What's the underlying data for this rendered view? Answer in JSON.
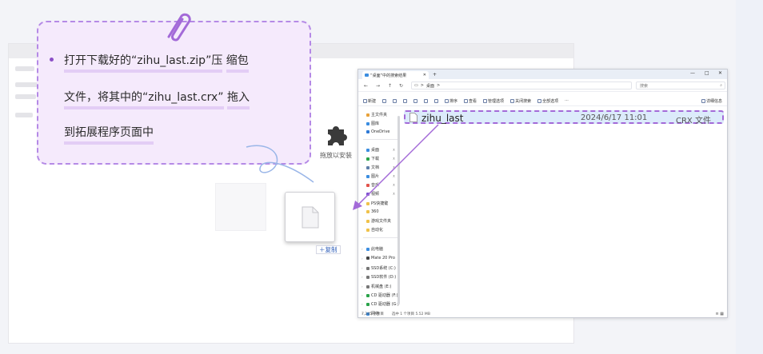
{
  "callout": {
    "line1_a": "打开下载好的“zihu_last.zip”压",
    "line1_b": "缩包",
    "line2_a": "文件，将其中的“zihu_last.crx”",
    "line2_b": "拖入",
    "line3": "到拓展程序页面中"
  },
  "drop_zone": {
    "label": "拖放以安装",
    "copy_badge": "＋复制"
  },
  "explorer": {
    "tab_title": "“桌面”中的搜索结果",
    "new_tab": "+",
    "controls": [
      "—",
      "□",
      "✕"
    ],
    "nav_buttons": [
      "←",
      "→",
      "↑",
      "↻",
      "▭",
      ">"
    ],
    "breadcrumb": "桌面",
    "breadcrumb_sep": ">",
    "search_placeholder": "搜索",
    "toolbar": [
      "新建",
      "✂",
      "⎘",
      "⎙",
      "⇄",
      "🗑",
      "排序",
      "查看",
      "筛选",
      "全部选择",
      "···"
    ],
    "toolbar_real": [
      "新建",
      "剪切",
      "复制",
      "粘贴",
      "重命名",
      "共享",
      "删除",
      "排序",
      "查看",
      "管理选项",
      "关闭搜索",
      "全部选项",
      "···"
    ],
    "details_label": "详细信息",
    "nav_items": [
      {
        "label": "主文件夹",
        "color": "#e8a23a"
      },
      {
        "label": "图库",
        "color": "#3b8de0"
      },
      {
        "label": "OneDrive",
        "color": "#2f7ad6"
      },
      {
        "label": "桌面",
        "color": "#3b8de0"
      },
      {
        "label": "下载",
        "color": "#2aa34a"
      },
      {
        "label": "文档",
        "color": "#5f7fa9"
      },
      {
        "label": "图片",
        "color": "#3b8de0"
      },
      {
        "label": "音乐",
        "color": "#e2544c"
      },
      {
        "label": "视频",
        "color": "#7b4fd0"
      },
      {
        "label": "PS快捷键",
        "color": "#f0c24a"
      },
      {
        "label": "360",
        "color": "#f0c24a"
      },
      {
        "label": "游戏文件夹",
        "color": "#f0c24a"
      },
      {
        "label": "自动化",
        "color": "#f0c24a"
      },
      {
        "label": "此电脑",
        "color": "#3b8de0"
      },
      {
        "label": "Mate 20 Pro",
        "color": "#444"
      },
      {
        "label": "SSD系统 (C:)",
        "color": "#777"
      },
      {
        "label": "SSD软件 (D:)",
        "color": "#777"
      },
      {
        "label": "机械盘 (E:)",
        "color": "#777"
      },
      {
        "label": "CD 驱动器 (F:)",
        "color": "#2aa34a"
      },
      {
        "label": "CD 驱动器 (G:)",
        "color": "#2aa34a"
      },
      {
        "label": "网络",
        "color": "#3b8de0"
      }
    ],
    "file": {
      "name": "zihu_last",
      "date": "2024/6/17 11:01",
      "type": "CRX 文件"
    },
    "status_count": "7,245 个项目",
    "status_selected": "选中 1 个项目 5.52 MB",
    "status_icons": "≡ ▦"
  },
  "colors": {
    "callout_border": "#b58ae6",
    "callout_bg": "#f5eafc",
    "arrow": "#a36ad8",
    "selection": "#dcebfb"
  }
}
